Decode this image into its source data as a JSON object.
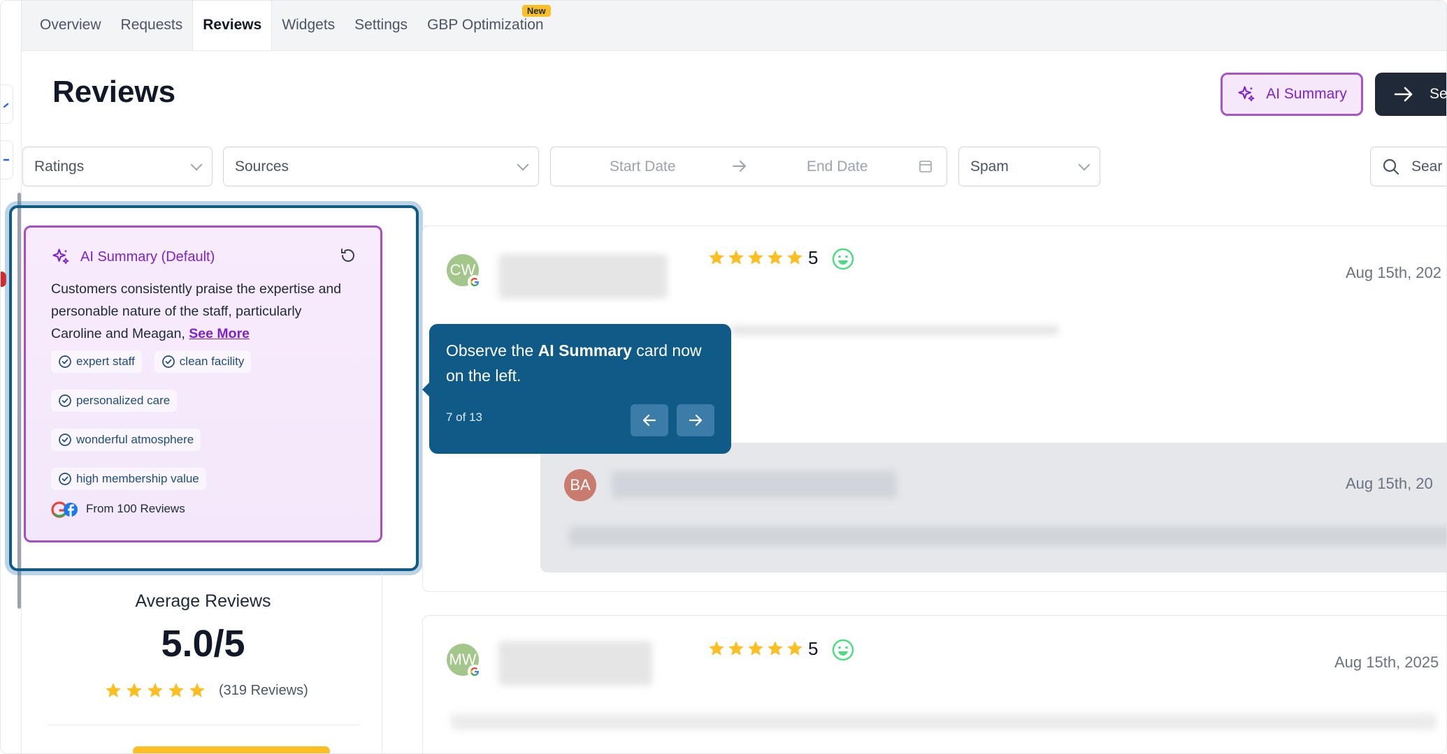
{
  "tabs": [
    {
      "label": "Overview"
    },
    {
      "label": "Requests"
    },
    {
      "label": "Reviews"
    },
    {
      "label": "Widgets"
    },
    {
      "label": "Settings"
    },
    {
      "label": "GBP Optimization",
      "badge": "New"
    }
  ],
  "header": {
    "title": "Reviews",
    "ai_summary_button": "AI Summary",
    "send_button": "Se"
  },
  "filters": {
    "ratings": "Ratings",
    "sources": "Sources",
    "start_date": "Start Date",
    "end_date": "End Date",
    "spam": "Spam",
    "search_placeholder": "Sear"
  },
  "ai_summary": {
    "title": "AI Summary (Default)",
    "text": "Customers consistently praise the expertise and personable nature of the staff, particularly Caroline and Meagan, ",
    "see_more": "See More",
    "tags": [
      "expert staff",
      "clean facility",
      "personalized care",
      "wonderful atmosphere",
      "high membership value"
    ],
    "from_label": "From 100 Reviews"
  },
  "average": {
    "title": "Average Reviews",
    "score": "5.0/5",
    "count": "(319 Reviews)",
    "stars": 5
  },
  "reviews": [
    {
      "initials": "CW",
      "rating": "5",
      "date": "Aug 15th, 202",
      "avatar_color": "#a3c78a"
    },
    {
      "initials": "MW",
      "rating": "5",
      "date": "Aug 15th, 2025",
      "avatar_color": "#a3c78a"
    }
  ],
  "reply": {
    "initials": "BA",
    "date": "Aug 15th, 20",
    "avatar_color": "#c97b6e"
  },
  "tooltip": {
    "text_pre": "Observe the ",
    "text_bold": "AI Summary",
    "text_post": " card now on the left.",
    "step": "7 of 13"
  },
  "colors": {
    "accent_purple": "#7e22ce",
    "tooltip_blue": "#0f5a87",
    "star": "#fbbf24",
    "dark_button": "#1f2937"
  }
}
